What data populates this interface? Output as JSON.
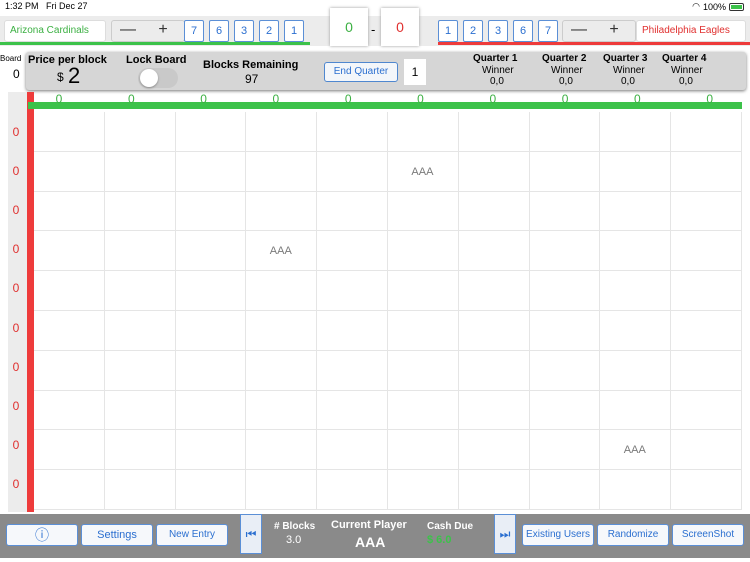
{
  "status_bar": {
    "time": "1:32 PM",
    "date": "Fri Dec 27",
    "battery": "100%"
  },
  "teams": {
    "left": {
      "name": "Arizona Cardinals",
      "score": "0",
      "color": "#3cc24a",
      "quarters": [
        "7",
        "6",
        "3",
        "2",
        "1"
      ]
    },
    "right": {
      "name": "Philadelphia Eagles",
      "score": "0",
      "color": "#ee3b3b",
      "quarters": [
        "1",
        "2",
        "3",
        "6",
        "7"
      ]
    },
    "score_separator": "-"
  },
  "stepper": {
    "minus": "—",
    "plus": "+"
  },
  "panel": {
    "board_label": "Board",
    "board_value": "0",
    "price_label": "Price per block",
    "price_currency": "$",
    "price_value": "2",
    "lock_label": "Lock Board",
    "blocks_label": "Blocks Remaining",
    "blocks_value": "97",
    "end_quarter_label": "End Quarter",
    "quarter_value": "1",
    "winners": [
      {
        "q": "Quarter 1",
        "w": "Winner",
        "v": "0,0"
      },
      {
        "q": "Quarter 2",
        "w": "Winner",
        "v": "0,0"
      },
      {
        "q": "Quarter 3",
        "w": "Winner",
        "v": "0,0"
      },
      {
        "q": "Quarter 4",
        "w": "Winner",
        "v": "0,0"
      }
    ]
  },
  "grid": {
    "col_numbers": [
      "0",
      "0",
      "0",
      "0",
      "0",
      "0",
      "0",
      "0",
      "0",
      "0"
    ],
    "row_numbers": [
      "0",
      "0",
      "0",
      "0",
      "0",
      "0",
      "0",
      "0",
      "0",
      "0"
    ],
    "cells": [
      {
        "row": 2,
        "col": 6,
        "text": "AAA"
      },
      {
        "row": 4,
        "col": 4,
        "text": "AAA"
      },
      {
        "row": 9,
        "col": 9,
        "text": "AAA"
      }
    ]
  },
  "toolbar": {
    "info_label": "ⓘ",
    "settings_label": "Settings",
    "new_entry_label": "New Entry",
    "prev_label": "⏮",
    "next_label": "⏭",
    "blocks_label": "# Blocks",
    "blocks_value": "3.0",
    "current_player_label": "Current Player",
    "current_player_value": "AAA",
    "cash_due_label": "Cash Due",
    "cash_due_value": "$ 6.0",
    "existing_users_label": "Existing Users",
    "randomize_label": "Randomize",
    "screenshot_label": "ScreenShot"
  }
}
